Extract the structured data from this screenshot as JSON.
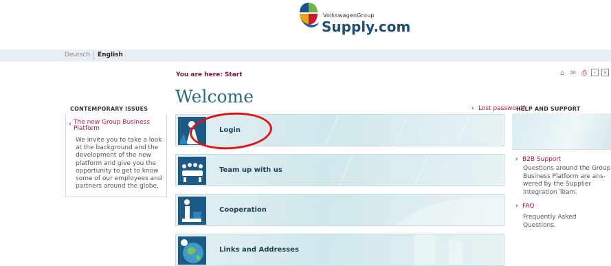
{
  "header": {
    "logo_small": "VolkswagenGroup",
    "logo_big": "Supply.com"
  },
  "language": {
    "items": [
      "Deutsch",
      "English"
    ],
    "active": "English"
  },
  "breadcrumb": "You are here:  Start",
  "page_title": "Welcome",
  "left": {
    "title": "CONTEMPORARY ISSUES",
    "link": "The new Group Business Platform",
    "text": "We invite you to take a look at the background and the development of the new platform and give you the opportunity to get to know some of our employees and partners around the globe."
  },
  "lost_password": "Lost password?",
  "tiles": [
    {
      "label": "Login",
      "icon": "login-person-icon"
    },
    {
      "label": "Team up with us",
      "icon": "team-meeting-icon"
    },
    {
      "label": "Cooperation",
      "icon": "cooperation-person-icon"
    },
    {
      "label": "Links and Addresses",
      "icon": "globe-icon"
    }
  ],
  "right": {
    "title": "HELP AND SUPPORT",
    "b2b_link": "B2B Support",
    "b2b_text": "Questions around the Group Business Platform are ans- wered by the Supplier Integration Team.",
    "faq_link": "FAQ",
    "faq_text": "Frequently Asked Questions."
  },
  "tools": [
    "home-icon",
    "mail-icon",
    "print-icon",
    "back-icon",
    "close-icon"
  ],
  "colors": {
    "accent_red": "#b0143e",
    "title_teal": "#2a6a82",
    "annotation_red": "#e01414"
  }
}
